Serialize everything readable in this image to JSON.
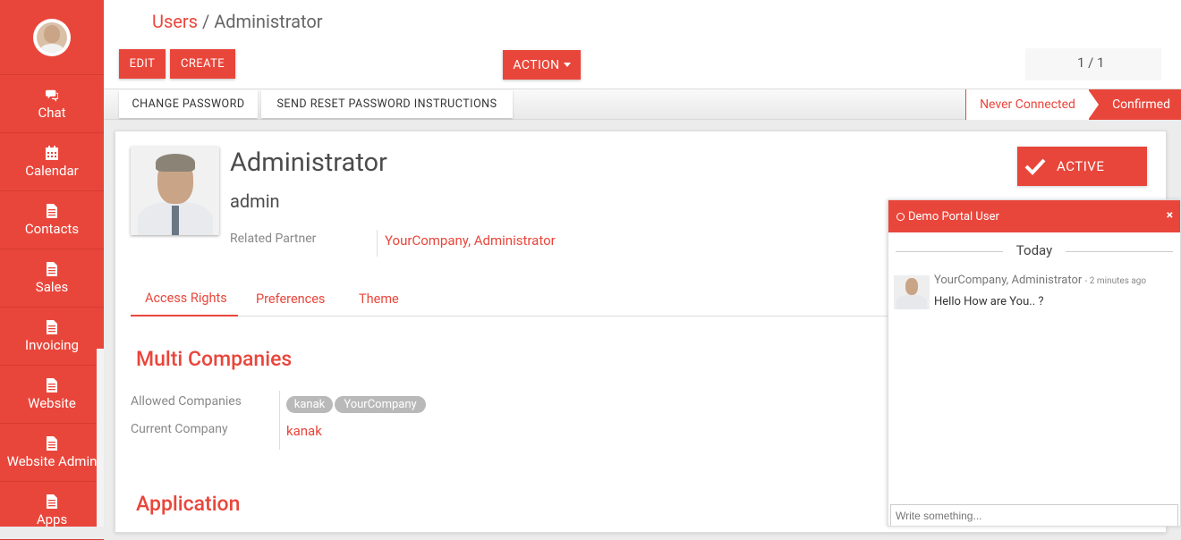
{
  "sidebar": {
    "items": [
      {
        "label": "Chat",
        "icon": "comments-icon"
      },
      {
        "label": "Calendar",
        "icon": "calendar-icon"
      },
      {
        "label": "Contacts",
        "icon": "file-icon"
      },
      {
        "label": "Sales",
        "icon": "file-icon"
      },
      {
        "label": "Invoicing",
        "icon": "file-icon"
      },
      {
        "label": "Website",
        "icon": "file-icon"
      },
      {
        "label": "Website Admin",
        "icon": "file-icon"
      },
      {
        "label": "Apps",
        "icon": "file-icon"
      }
    ]
  },
  "breadcrumb": {
    "parent": "Users",
    "separator": "/",
    "current": "Administrator"
  },
  "toolbar": {
    "edit": "EDIT",
    "create": "CREATE",
    "action": "ACTION",
    "pager": "1 / 1"
  },
  "statusbar": {
    "change_password": "CHANGE PASSWORD",
    "send_reset": "SEND RESET PASSWORD INSTRUCTIONS",
    "stage_never": "Never Connected",
    "stage_confirmed": "Confirmed"
  },
  "form": {
    "name": "Administrator",
    "login": "admin",
    "related_partner_label": "Related Partner",
    "related_partner_value": "YourCompany, Administrator",
    "active_label": "ACTIVE",
    "tabs": [
      "Access Rights",
      "Preferences",
      "Theme"
    ],
    "multi_companies_title": "Multi Companies",
    "allowed_companies_label": "Allowed Companies",
    "allowed_companies": [
      "kanak",
      "YourCompany"
    ],
    "current_company_label": "Current Company",
    "current_company_value": "kanak",
    "application_title": "Application"
  },
  "chat": {
    "title": "Demo Portal User",
    "close": "×",
    "day": "Today",
    "message": {
      "author": "YourCompany, Administrator",
      "time": "- 2 minutes ago",
      "body": "Hello How are You.. ?"
    },
    "input_placeholder": "Write something..."
  },
  "colors": {
    "accent": "#e9463b"
  }
}
